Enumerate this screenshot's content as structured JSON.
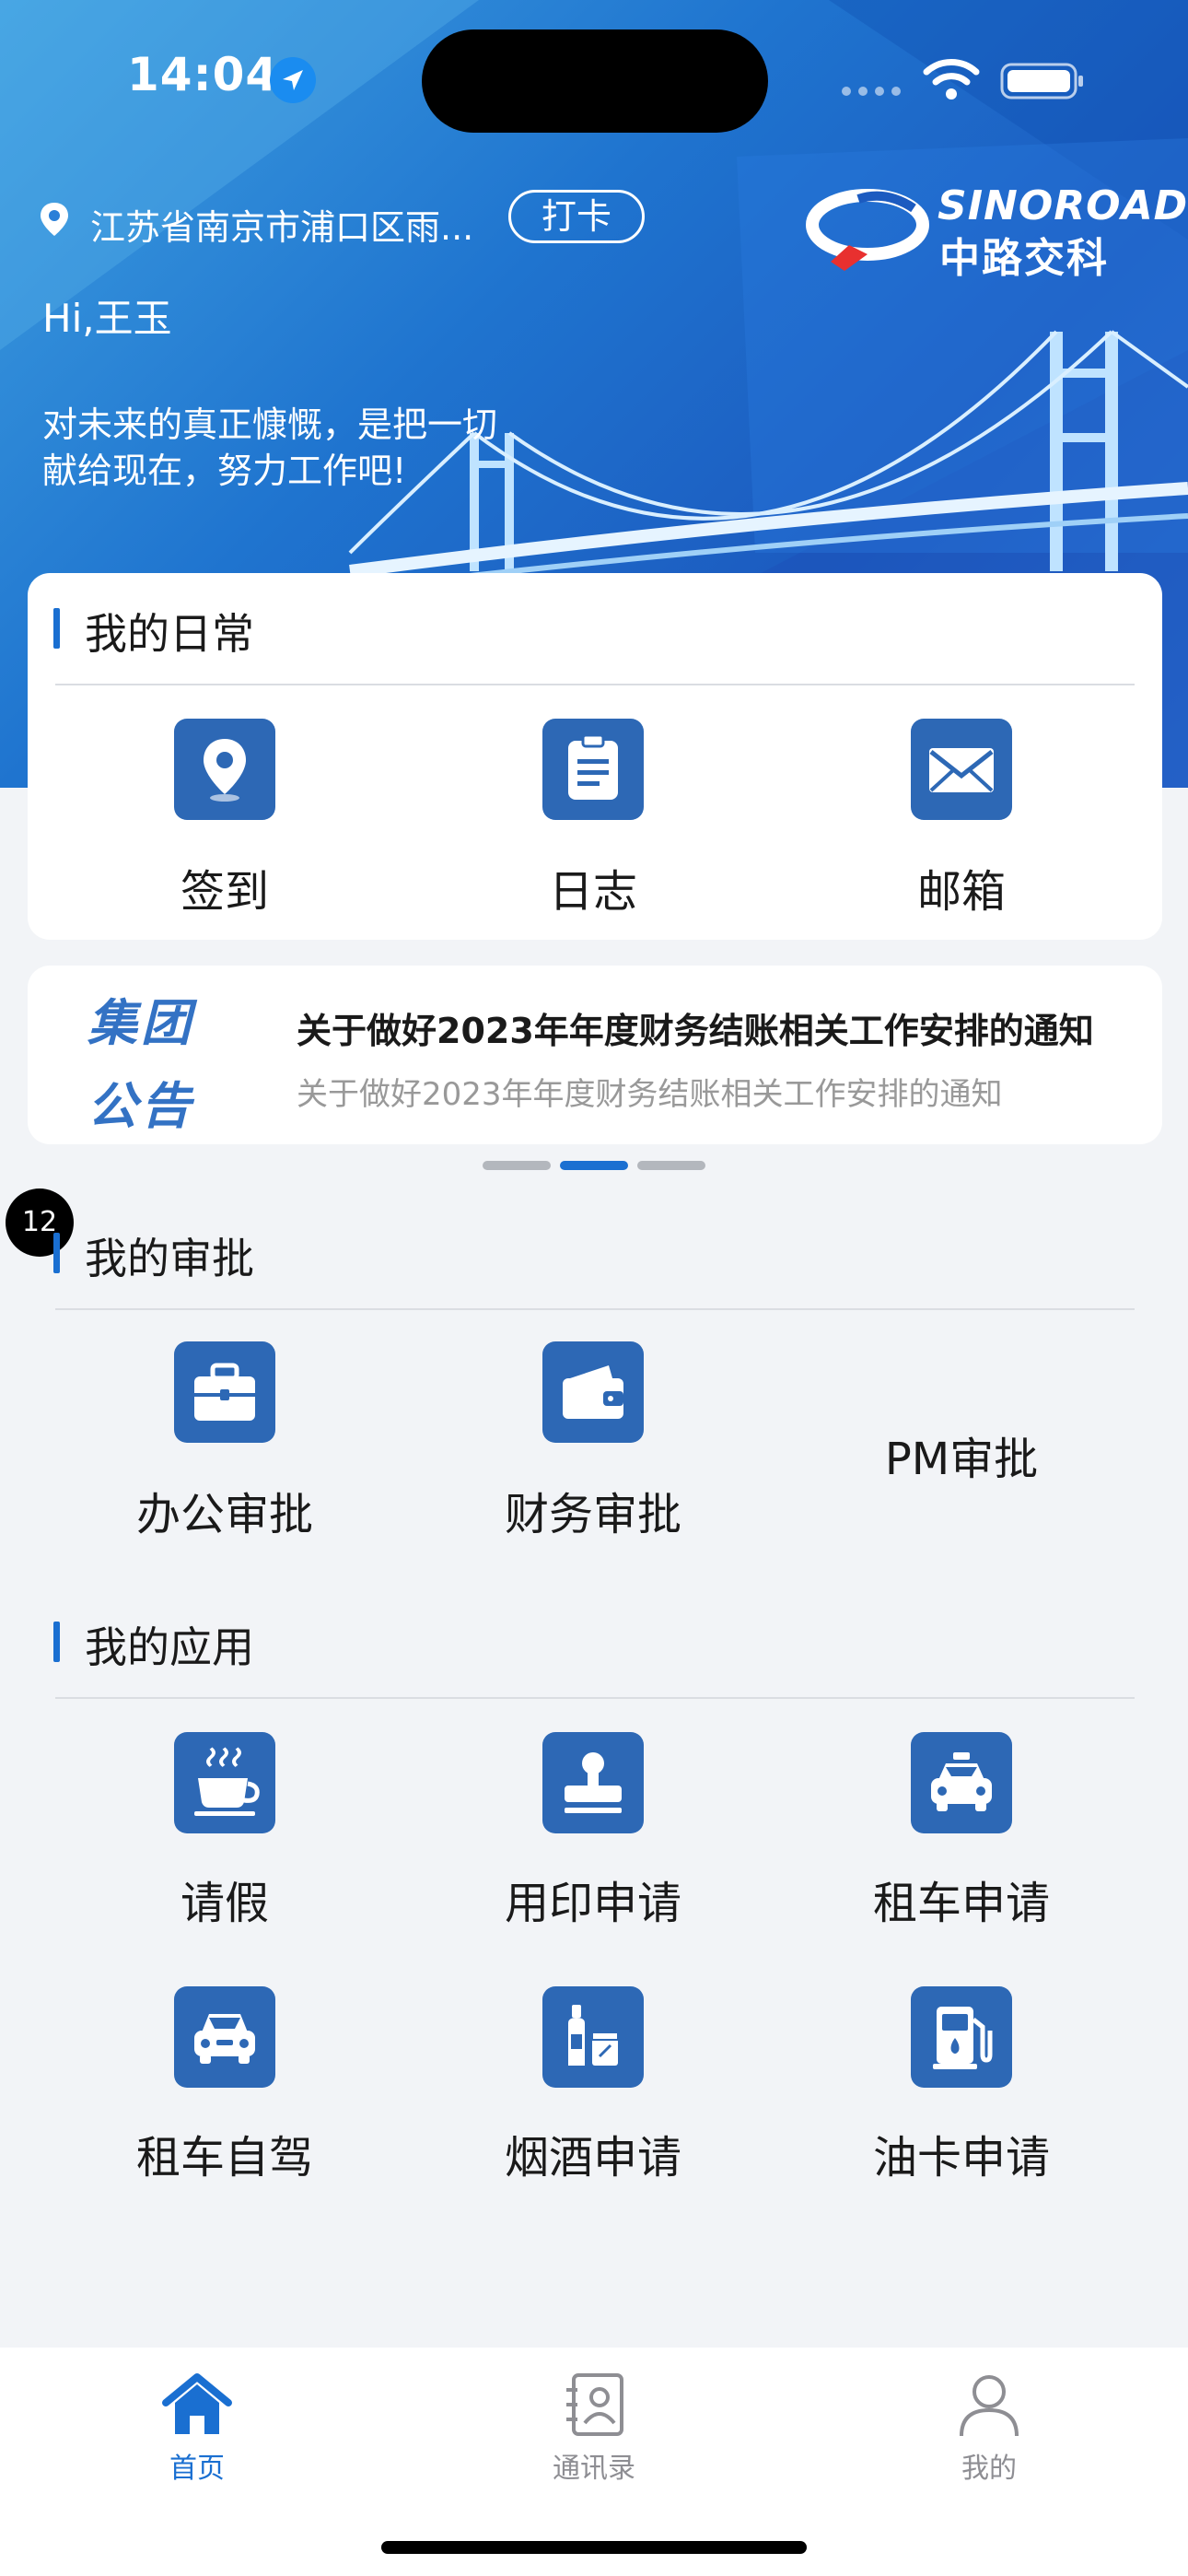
{
  "status_bar": {
    "time": "14:04"
  },
  "header": {
    "location": "江苏省南京市浦口区雨...",
    "punch_label": "打卡",
    "greeting": "Hi,王玉",
    "motto_line1": "对未来的真正慷慨，是把一切",
    "motto_line2": "献给现在，努力工作吧!",
    "logo_title": "SINOROAD",
    "logo_subtitle": "中路交科"
  },
  "daily": {
    "title": "我的日常",
    "items": [
      {
        "label": "签到",
        "icon": "location-pin-icon"
      },
      {
        "label": "日志",
        "icon": "log-document-icon"
      },
      {
        "label": "邮箱",
        "icon": "mail-icon"
      }
    ]
  },
  "notice": {
    "tag_line1": "集团",
    "tag_line2": "公告",
    "title": "关于做好2023年年度财务结账相关工作安排的通知",
    "subtitle": "关于做好2023年年度财务结账相关工作安排的通知",
    "pager_count": 3,
    "pager_active": 1
  },
  "badge_count": "12",
  "approvals": {
    "title": "我的审批",
    "items": [
      {
        "label": "办公审批",
        "icon": "briefcase-icon"
      },
      {
        "label": "财务审批",
        "icon": "wallet-icon"
      },
      {
        "label": "PM审批"
      }
    ]
  },
  "apps": {
    "title": "我的应用",
    "items": [
      {
        "label": "请假",
        "icon": "coffee-cup-icon"
      },
      {
        "label": "用印申请",
        "icon": "stamp-icon"
      },
      {
        "label": "租车申请",
        "icon": "taxi-icon"
      },
      {
        "label": "租车自驾",
        "icon": "car-icon"
      },
      {
        "label": "烟酒申请",
        "icon": "bottle-icon"
      },
      {
        "label": "油卡申请",
        "icon": "fuel-pump-icon"
      }
    ]
  },
  "tabbar": {
    "items": [
      {
        "label": "首页",
        "active": true
      },
      {
        "label": "通讯录",
        "active": false
      },
      {
        "label": "我的",
        "active": false
      }
    ]
  },
  "colors": {
    "accent": "#1a6fd1",
    "tile": "#2d68b5",
    "inactive": "#8e8e93"
  }
}
